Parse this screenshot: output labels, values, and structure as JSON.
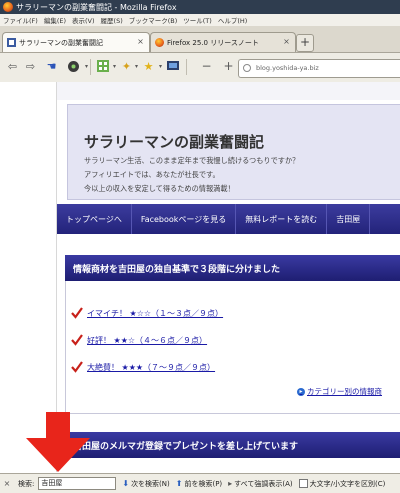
{
  "window": {
    "title": "サラリーマンの副業奮闘記 - Mozilla Firefox"
  },
  "menu": [
    "ファイル(F)",
    "編集(E)",
    "表示(V)",
    "履歴(S)",
    "ブックマーク(B)",
    "ツール(T)",
    "ヘルプ(H)"
  ],
  "tabs": [
    {
      "label": "サラリーマンの副業奮闘記",
      "active": true
    },
    {
      "label": "Firefox 25.0 リリースノート",
      "active": false
    }
  ],
  "navbar": {
    "url": "blog.yoshida-ya.biz"
  },
  "site": {
    "title": "サラリーマンの副業奮闘記",
    "desc": [
      "サラリーマン生活、このまま定年まで我慢し続けるつもりですか？",
      "アフィリエイトでは、あなたが社長です。",
      "今以上の収入を安定して得るための情報満載！"
    ]
  },
  "nav_menu": [
    "トップページへ",
    "Facebookページを見る",
    "無料レポートを読む",
    "吉田屋"
  ],
  "section1": {
    "heading": "情報商材を吉田屋の独自基準で３段階に分けました",
    "items": [
      "イマイチ！ ★☆☆（１～３点／９点）",
      "好評！ ★★☆（４～６点／９点）",
      "大絶賛！ ★★★（７～９点／９点）"
    ],
    "category_link": "カテゴリー別の情報商"
  },
  "section2": {
    "heading": "吉田屋のメルマガ登録でプレゼントを差し上げています"
  },
  "findbar": {
    "label": "検索:",
    "query": "吉田屋",
    "next": "次を検索(N)",
    "prev": "前を検索(P)",
    "highlight": "すべて強調表示(A)",
    "match_case": "大文字/小文字を区別(C)"
  },
  "colors": {
    "nav_blue": "#2b2b8c",
    "annotation_red": "#e8251b",
    "link_blue": "#1a1aa6"
  }
}
